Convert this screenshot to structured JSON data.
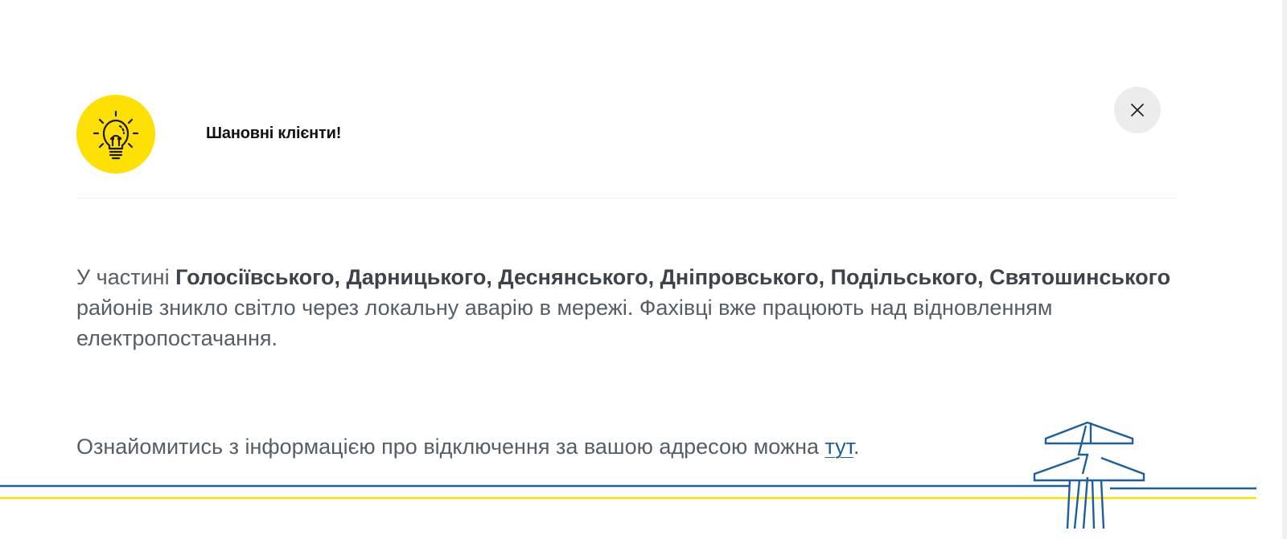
{
  "modal": {
    "title": "Шановні клієнти!",
    "close_icon": "close-icon",
    "header_icon": "lightbulb-icon",
    "body": {
      "intro": "У частині ",
      "districts": "Голосіївського, Дарницького, Деснянського, Дніпровського, Подільського, Святошинського",
      "rest": " районів зникло світло через локальну аварію в мережі. Фахівці вже працюють над відновленням електропостачання."
    },
    "info": {
      "text": "Ознайомитись з інформацією про відключення за вашою адресою можна ",
      "link_label": "тут",
      "suffix": "."
    }
  },
  "colors": {
    "brand_yellow": "#ffe003",
    "brand_blue": "#1d5f9e",
    "text_gray": "#555d66"
  }
}
